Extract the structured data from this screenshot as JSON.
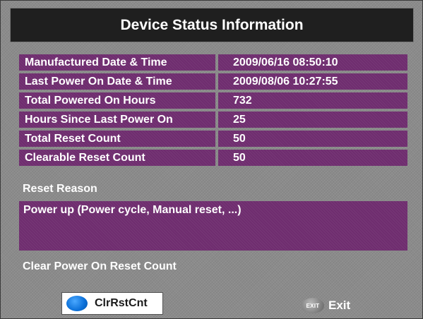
{
  "dialog": {
    "title": "Device Status Information"
  },
  "status_rows": [
    {
      "label": "Manufactured Date & Time",
      "value": "2009/06/16 08:50:10"
    },
    {
      "label": "Last Power On Date & Time",
      "value": "2009/08/06 10:27:55"
    },
    {
      "label": "Total Powered On Hours",
      "value": "732"
    },
    {
      "label": "Hours Since Last Power On",
      "value": "25"
    },
    {
      "label": "Total Reset Count",
      "value": "50"
    },
    {
      "label": "Clearable Reset Count",
      "value": "50"
    }
  ],
  "reset_reason": {
    "label": "Reset Reason",
    "value": "Power up (Power cycle, Manual reset, ...)"
  },
  "clear_section": {
    "label": "Clear Power On Reset Count"
  },
  "buttons": {
    "clear": {
      "label": "ClrRstCnt",
      "icon": "blue-circle-icon"
    },
    "exit": {
      "label": "Exit",
      "icon_text": "EXIT",
      "icon": "exit-icon"
    }
  },
  "colors": {
    "title_bar": "#1f1f1f",
    "row_fill": "#6f2d6f",
    "panel": "#8b8b8b",
    "clear_button_accent": "#0a6fd8"
  }
}
